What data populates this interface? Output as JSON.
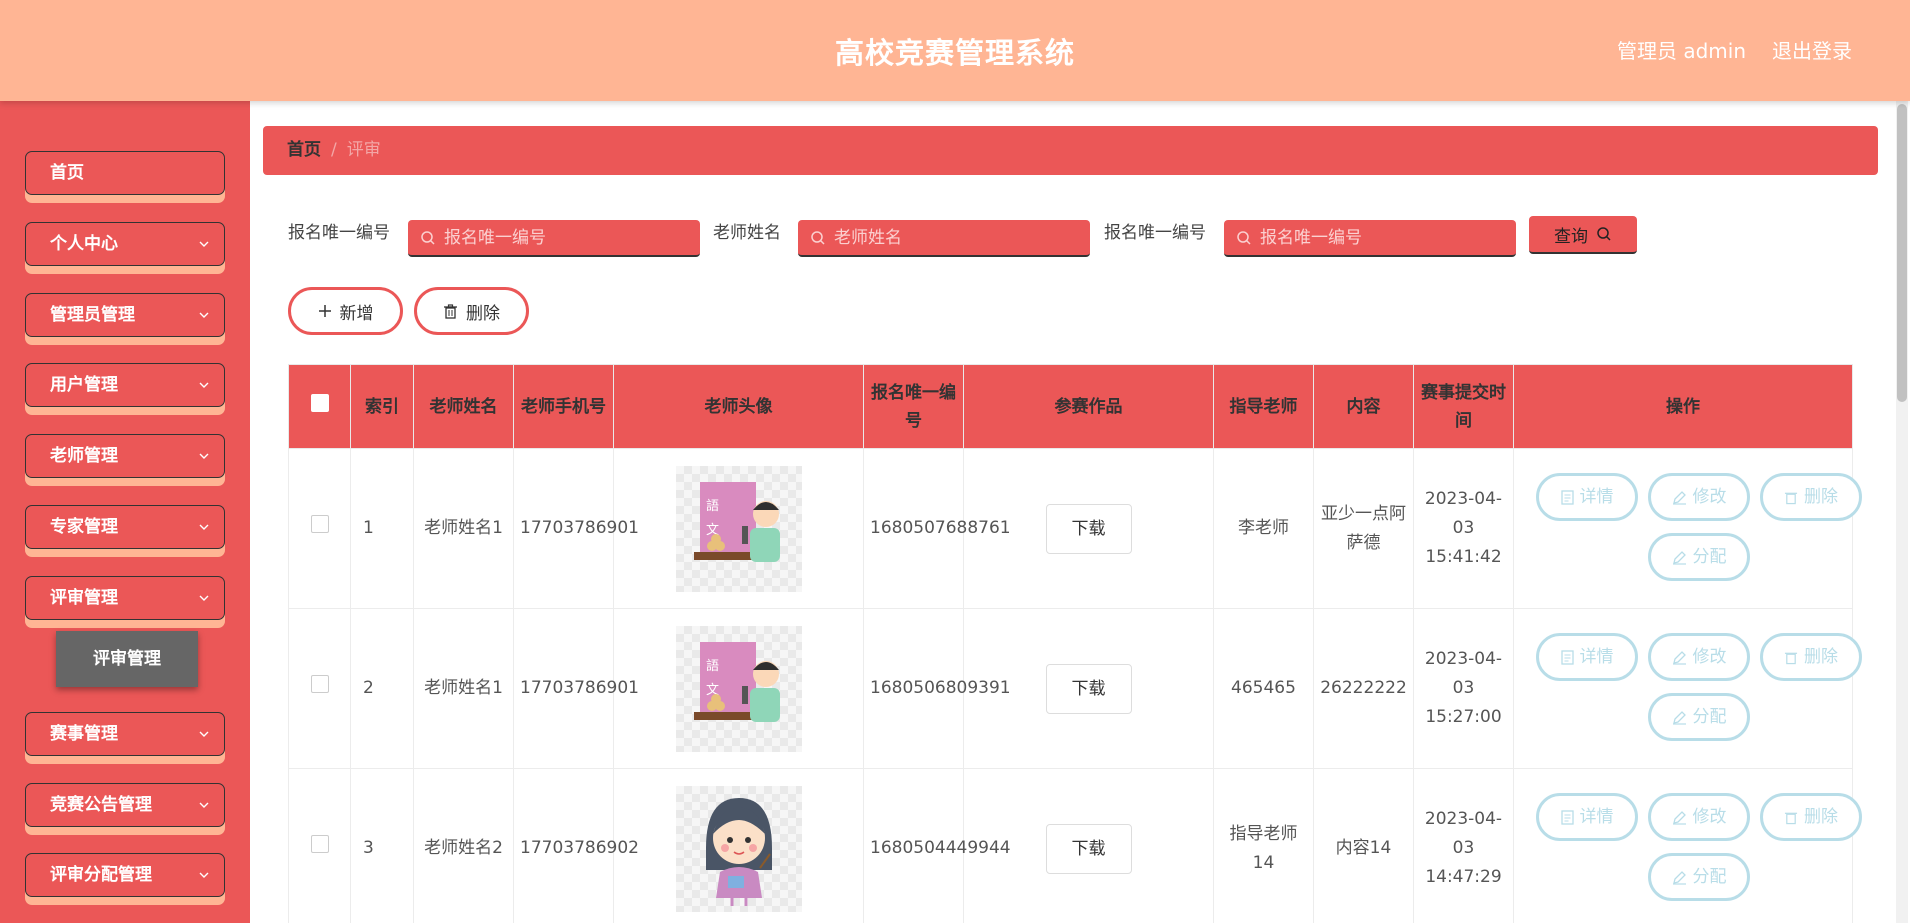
{
  "header": {
    "title": "高校竞赛管理系统",
    "user": "管理员 admin",
    "logout": "退出登录"
  },
  "sidebar": {
    "items": [
      {
        "label": "首页",
        "has_children": false
      },
      {
        "label": "个人中心",
        "has_children": true
      },
      {
        "label": "管理员管理",
        "has_children": true
      },
      {
        "label": "用户管理",
        "has_children": true
      },
      {
        "label": "老师管理",
        "has_children": true
      },
      {
        "label": "专家管理",
        "has_children": true
      },
      {
        "label": "评审管理",
        "has_children": true
      },
      {
        "label": "赛事管理",
        "has_children": true
      },
      {
        "label": "竞赛公告管理",
        "has_children": true
      },
      {
        "label": "评审分配管理",
        "has_children": true
      }
    ],
    "submenu": {
      "label": "评审管理"
    }
  },
  "breadcrumb": {
    "home": "首页",
    "separator": "/",
    "current": "评审"
  },
  "filters": [
    {
      "label": "报名唯一编号",
      "placeholder": "报名唯一编号"
    },
    {
      "label": "老师姓名",
      "placeholder": "老师姓名"
    },
    {
      "label": "报名唯一编号",
      "placeholder": "报名唯一编号"
    }
  ],
  "search_button": "查询",
  "actions": {
    "add": "新增",
    "delete": "删除"
  },
  "table": {
    "headers": [
      "",
      "索引",
      "老师姓名",
      "老师手机号",
      "老师头像",
      "报名唯一编号",
      "参赛作品",
      "指导老师",
      "内容",
      "赛事提交时间",
      "操作"
    ],
    "rows": [
      {
        "index": "1",
        "teacher_name": "老师姓名1",
        "phone": "17703786901",
        "avatar": "teacher-male-icon",
        "reg_id": "1680507688761",
        "work": "下载",
        "advisor": "李老师",
        "content": "亚少一点阿萨德",
        "time": "2023-04-03 15:41:42"
      },
      {
        "index": "2",
        "teacher_name": "老师姓名1",
        "phone": "17703786901",
        "avatar": "teacher-male-icon",
        "reg_id": "1680506809391",
        "work": "下载",
        "advisor": "465465",
        "content": "26222222",
        "time": "2023-04-03 15:27:00"
      },
      {
        "index": "3",
        "teacher_name": "老师姓名2",
        "phone": "17703786902",
        "avatar": "teacher-female-icon",
        "reg_id": "1680504449944",
        "work": "下载",
        "advisor": "指导老师14",
        "content": "内容14",
        "time": "2023-04-03 14:47:29"
      }
    ],
    "ops": {
      "detail": "详情",
      "edit": "修改",
      "delete": "删除",
      "assign": "分配"
    }
  },
  "colors": {
    "primary": "#eb5757",
    "header": "#ffb594",
    "op_border": "#b8dde8",
    "submenu": "#666666"
  }
}
